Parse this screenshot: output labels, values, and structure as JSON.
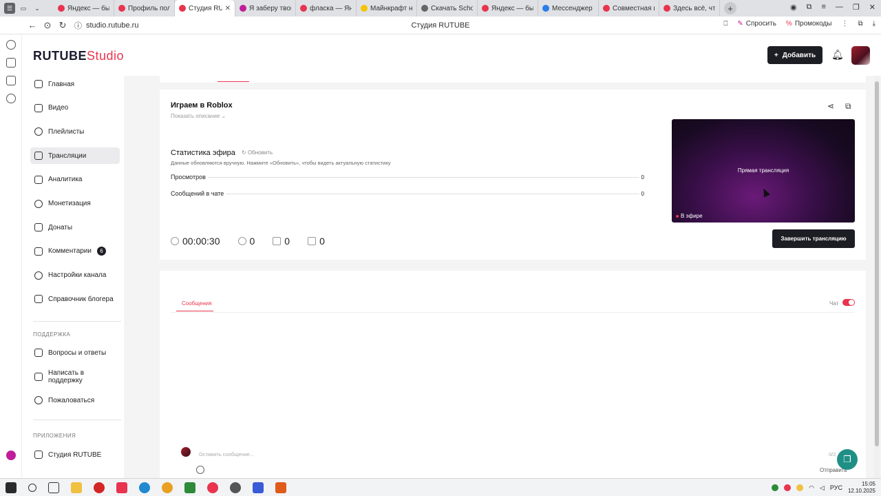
{
  "browser": {
    "tabs": [
      {
        "label": "Яндекс — быс",
        "color": "#e8344e"
      },
      {
        "label": "Профиль поль",
        "color": "#e8344e"
      },
      {
        "label": "Студия RUT",
        "color": "#e8344e",
        "active": true
      },
      {
        "label": "Я заберу твои",
        "color": "#c01d9a"
      },
      {
        "label": "флаcка — Янд",
        "color": "#e8344e"
      },
      {
        "label": "Майнкрафт н",
        "color": "#f4c400"
      },
      {
        "label": "Скачать Scho",
        "color": "#666666"
      },
      {
        "label": "Яндекс — быс",
        "color": "#e8344e"
      },
      {
        "label": "Мессенджер",
        "color": "#2b7de9"
      },
      {
        "label": "Совместная и",
        "color": "#e8344e"
      },
      {
        "label": "Здесь всё, что",
        "color": "#e8344e"
      }
    ],
    "url": "studio.rutube.ru",
    "page_title": "Студия RUTUBE",
    "ask_label": "Спросить",
    "promo_label": "Промокоды"
  },
  "header": {
    "logo_main": "RUTUBE",
    "logo_studio": "Studio",
    "add_label": "Добавить"
  },
  "sidebar": {
    "items": [
      {
        "label": "Главная",
        "icon": "home-icon"
      },
      {
        "label": "Видео",
        "icon": "video-icon"
      },
      {
        "label": "Плейлисты",
        "icon": "playlist-icon"
      },
      {
        "label": "Трансляции",
        "icon": "broadcast-icon",
        "active": true
      },
      {
        "label": "Аналитика",
        "icon": "analytics-icon"
      },
      {
        "label": "Монетизация",
        "icon": "monetization-icon"
      },
      {
        "label": "Донаты",
        "icon": "donate-icon"
      },
      {
        "label": "Комментарии",
        "icon": "comments-icon",
        "badge": "6"
      },
      {
        "label": "Настройки канала",
        "icon": "settings-icon"
      },
      {
        "label": "Справочник блогера",
        "icon": "info-icon"
      }
    ],
    "support_heading": "ПОДДЕРЖКА",
    "support_items": [
      {
        "label": "Вопросы и ответы",
        "icon": "faq-icon"
      },
      {
        "label": "Написать в поддержку",
        "icon": "mail-icon"
      },
      {
        "label": "Пожаловаться",
        "icon": "flag-icon"
      }
    ],
    "apps_heading": "ПРИЛОЖЕНИЯ",
    "apps_items": [
      {
        "label": "Студия RUTUBE",
        "icon": "studio-app-icon"
      }
    ]
  },
  "stream": {
    "title": "Играем в Roblox",
    "show_description": "Показать описание",
    "stats_title": "Статистика эфира",
    "refresh_label": "Обновить",
    "stats_note": "Данные обновляются вручную. Нажмите «Обновить», чтобы видеть актуальную статистику",
    "stats": [
      {
        "label": "Просмотров",
        "value": "0"
      },
      {
        "label": "Сообщений в чате",
        "value": "0"
      }
    ],
    "duration": "00:00:30",
    "viewers": "0",
    "likes": "0",
    "dislikes": "0",
    "player_title": "Прямая трансляция",
    "on_air": "В эфире",
    "end_label": "Завершить трансляцию"
  },
  "chat": {
    "tab_label": "Сообщения",
    "chat_label": "Чат",
    "chat_enabled": true,
    "input_placeholder": "Оставить сообщение...",
    "char_limit": "0/2",
    "send_label": "Отправить"
  },
  "taskbar": {
    "language": "РУС",
    "time": "15:05",
    "date": "12.10.2025"
  }
}
